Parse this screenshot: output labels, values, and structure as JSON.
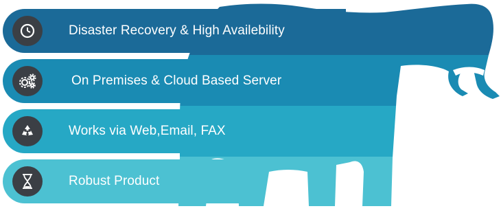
{
  "features": [
    {
      "label": "Disaster Recovery & High Availebility",
      "icon": "clock-icon",
      "color": "#1b6a98"
    },
    {
      "label": "On Premises & Cloud Based Server",
      "icon": "gears-icon",
      "color": "#1a8bb3"
    },
    {
      "label": "Works via Web,Email, FAX",
      "icon": "recycle-icon",
      "color": "#26a8c5"
    },
    {
      "label": "Robust Product",
      "icon": "hourglass-icon",
      "color": "#4cc1d2"
    }
  ],
  "colors": {
    "icon_circle": "#3b3f45",
    "text": "#ffffff"
  }
}
